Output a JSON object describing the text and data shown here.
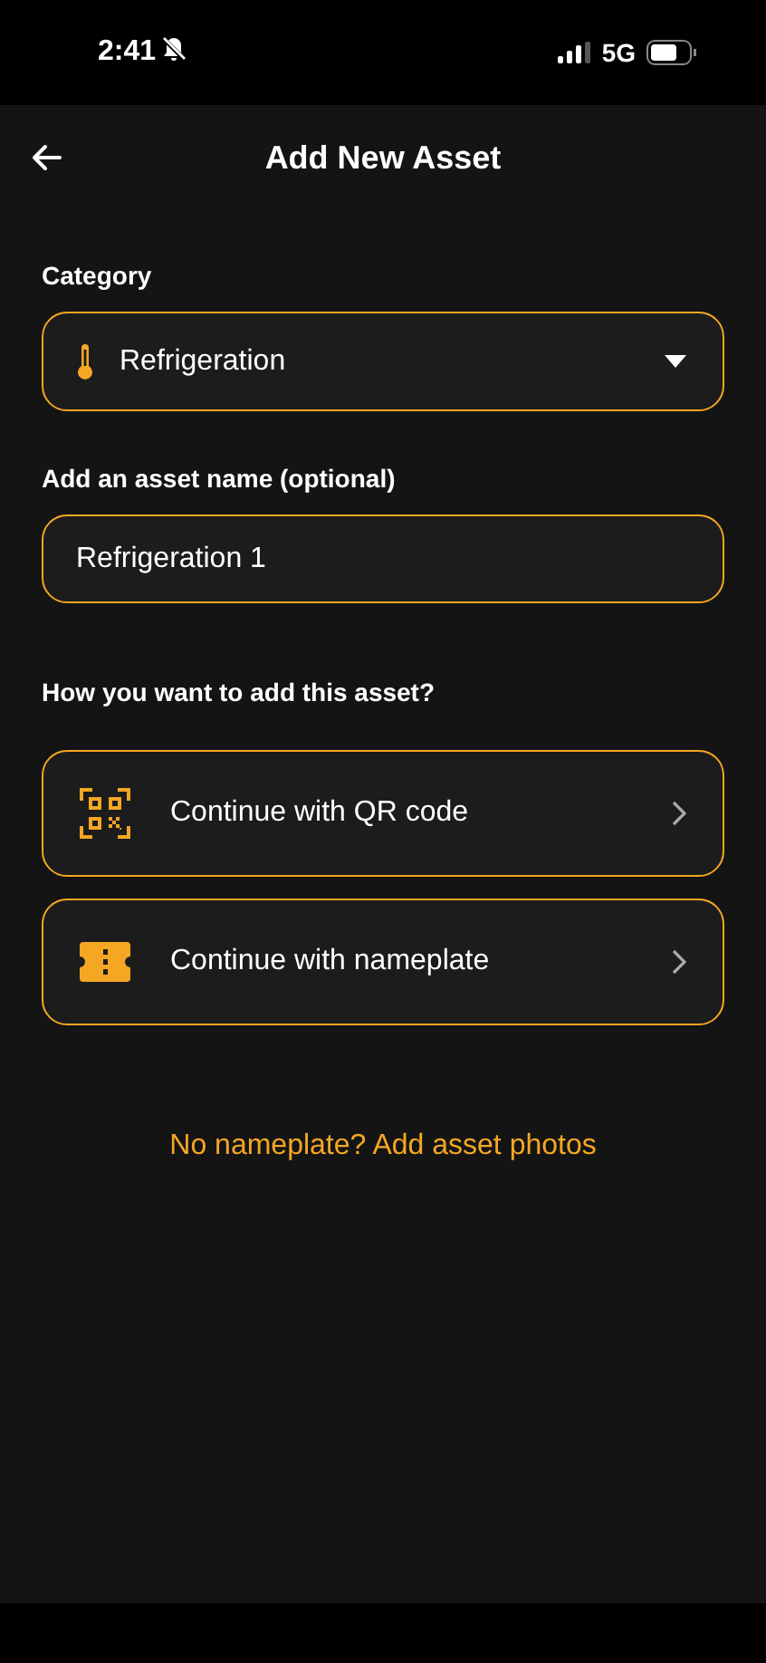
{
  "status_bar": {
    "time": "2:41",
    "network": "5G",
    "silent": true
  },
  "header": {
    "title": "Add New Asset"
  },
  "category": {
    "label": "Category",
    "value": "Refrigeration"
  },
  "asset_name": {
    "label": "Add an asset name (optional)",
    "value": "Refrigeration 1"
  },
  "method": {
    "question": "How you want to add this asset?",
    "options": [
      {
        "kind": "qr",
        "label": "Continue with QR code"
      },
      {
        "kind": "nameplate",
        "label": "Continue with nameplate"
      }
    ]
  },
  "footer_link": "No nameplate? Add asset photos"
}
